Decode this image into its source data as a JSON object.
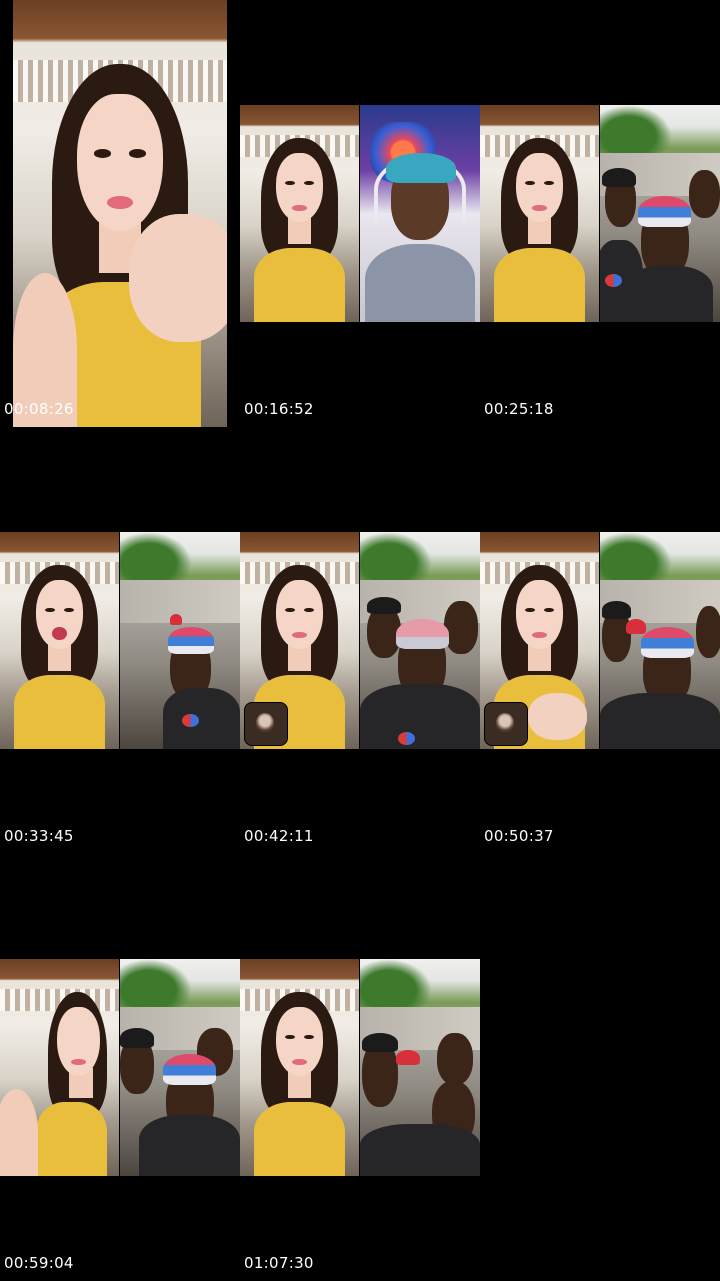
{
  "thumbnails": [
    {
      "timestamp": "00:08:26",
      "layout": "single",
      "panels": [
        "woman"
      ]
    },
    {
      "timestamp": "00:16:52",
      "layout": "split-wide",
      "panels": [
        "woman",
        "streamer"
      ]
    },
    {
      "timestamp": "00:25:18",
      "layout": "split-wide",
      "panels": [
        "woman",
        "group"
      ]
    },
    {
      "timestamp": "00:33:45",
      "layout": "split",
      "panels": [
        "woman",
        "group"
      ]
    },
    {
      "timestamp": "00:42:11",
      "layout": "split",
      "panels": [
        "woman",
        "group"
      ],
      "pip": true
    },
    {
      "timestamp": "00:50:37",
      "layout": "split",
      "panels": [
        "woman",
        "group"
      ],
      "pip": true
    },
    {
      "timestamp": "00:59:04",
      "layout": "split",
      "panels": [
        "woman",
        "group"
      ]
    },
    {
      "timestamp": "01:07:30",
      "layout": "split",
      "panels": [
        "woman",
        "group"
      ]
    }
  ],
  "colors": {
    "background": "#000000",
    "timestamp_text": "#ffffff",
    "yellow_top": "#e8be3c"
  }
}
